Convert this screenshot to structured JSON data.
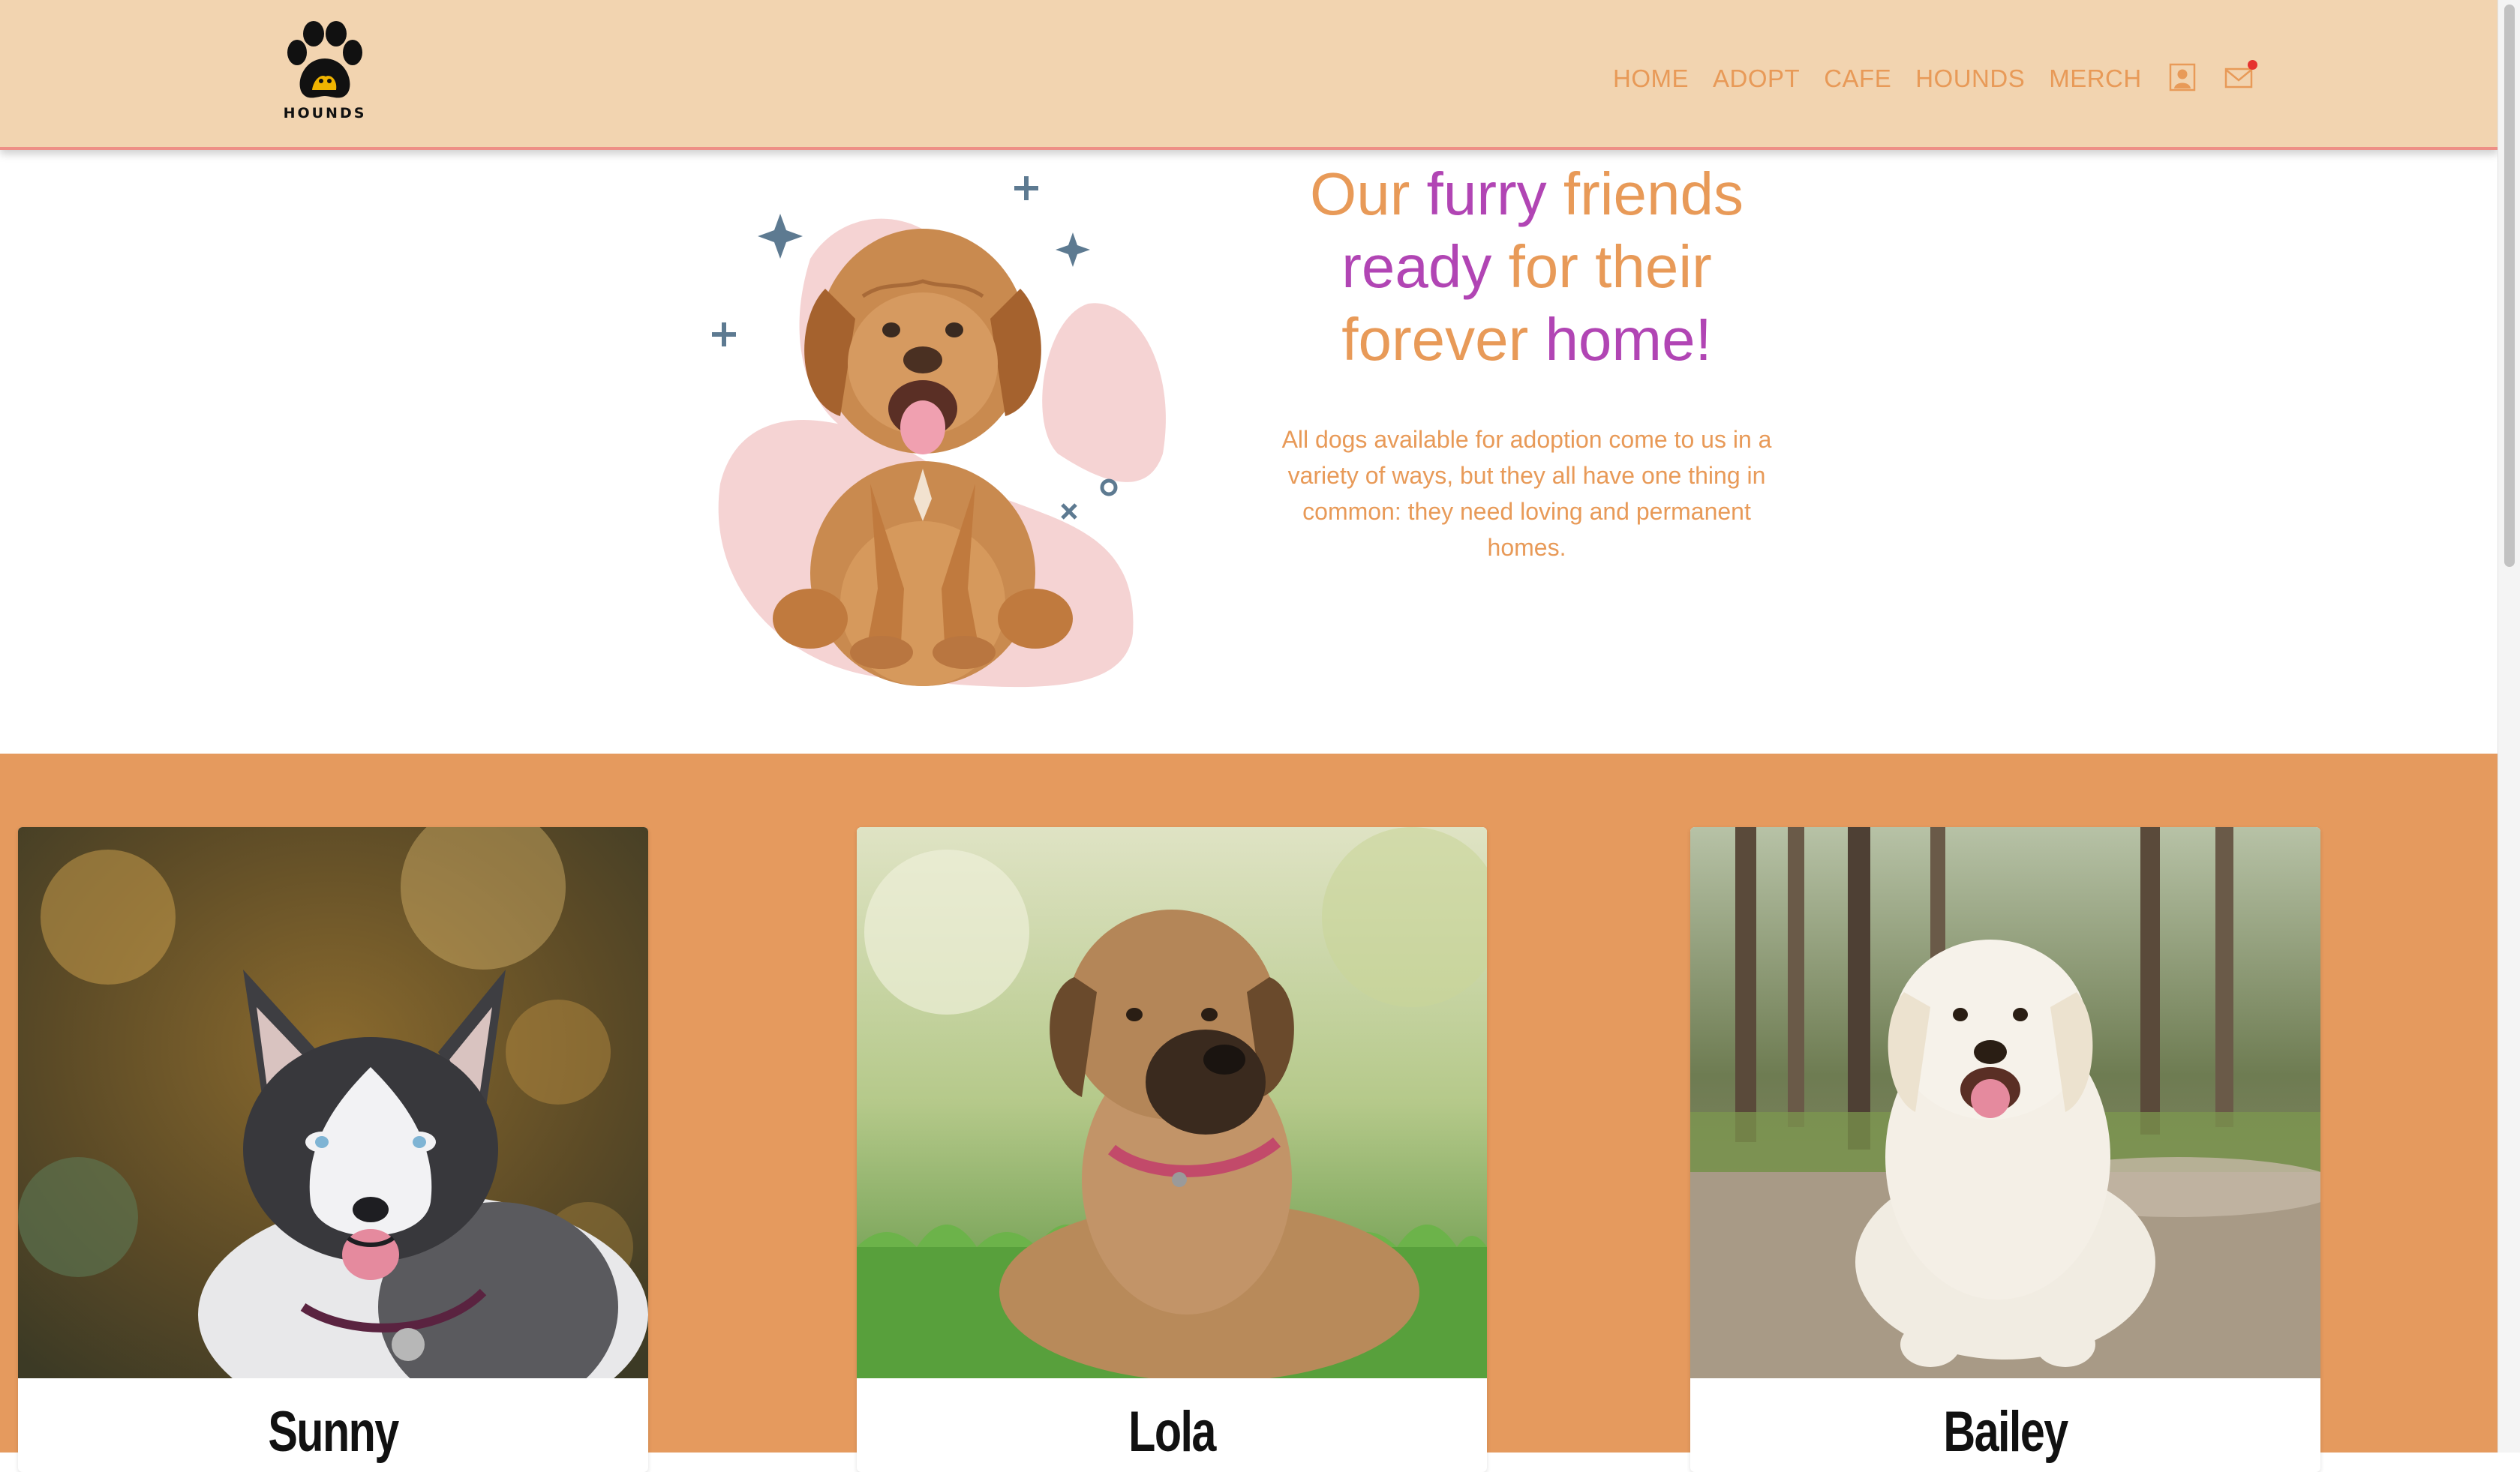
{
  "brand": {
    "name": "HOUNDS",
    "logo_icon": "paw-logo-icon"
  },
  "nav": {
    "items": [
      {
        "label": "HOME"
      },
      {
        "label": "ADOPT"
      },
      {
        "label": "CAFE"
      },
      {
        "label": "HOUNDS"
      },
      {
        "label": "MERCH"
      }
    ],
    "account_icon": "user-icon",
    "mail_icon": "mail-icon",
    "mail_has_notification": true
  },
  "hero": {
    "title_parts": [
      "Our ",
      "furry",
      " friends",
      "ready",
      " for their",
      "forever ",
      "home!"
    ],
    "description": "All dogs available for adoption come to us in a variety of ways, but they all have one thing in common: they need loving and permanent homes."
  },
  "dogs": [
    {
      "name": "Sunny",
      "photo": "husky-photo"
    },
    {
      "name": "Lola",
      "photo": "brown-dog-photo"
    },
    {
      "name": "Bailey",
      "photo": "golden-retriever-photo"
    }
  ],
  "colors": {
    "header_bg": "#f2d4b0",
    "accent_orange": "#e89a58",
    "accent_purple": "#b145b4",
    "section_bg": "#e59a5e",
    "header_border": "#ee8f86"
  }
}
